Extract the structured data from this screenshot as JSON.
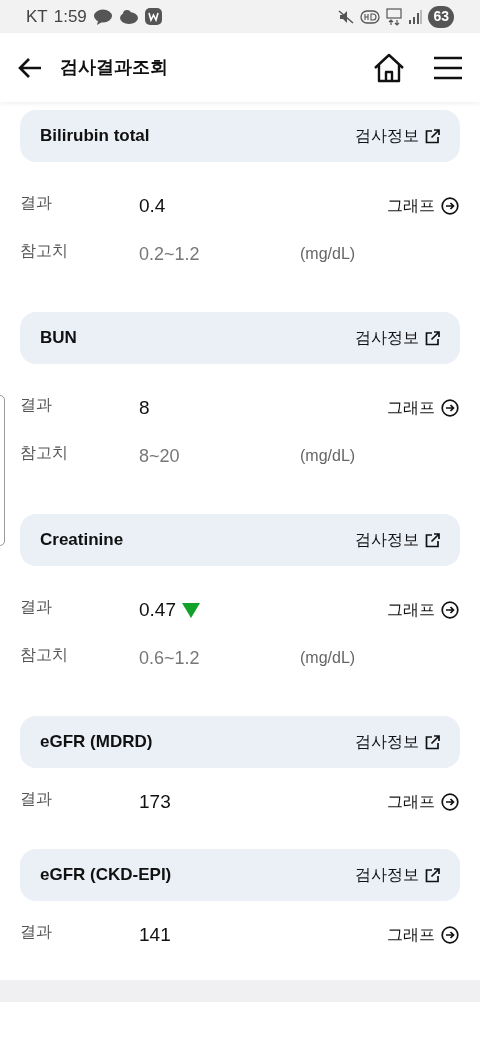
{
  "status_bar": {
    "carrier": "KT",
    "time": "1:59",
    "battery": "63"
  },
  "header": {
    "title": "검사결과조회"
  },
  "tests": [
    {
      "name": "Bilirubin total",
      "info_link": "검사정보",
      "result_label": "결과",
      "result": "0.4",
      "below_range": false,
      "graph_link": "그래프",
      "reference_label": "참고치",
      "reference": "0.2~1.2",
      "unit": "(mg/dL)"
    },
    {
      "name": "BUN",
      "info_link": "검사정보",
      "result_label": "결과",
      "result": "8",
      "below_range": false,
      "graph_link": "그래프",
      "reference_label": "참고치",
      "reference": "8~20",
      "unit": "(mg/dL)"
    },
    {
      "name": "Creatinine",
      "info_link": "검사정보",
      "result_label": "결과",
      "result": "0.47",
      "below_range": true,
      "graph_link": "그래프",
      "reference_label": "참고치",
      "reference": "0.6~1.2",
      "unit": "(mg/dL)"
    },
    {
      "name": "eGFR (MDRD)",
      "info_link": "검사정보",
      "result_label": "결과",
      "result": "173",
      "below_range": false,
      "graph_link": "그래프"
    },
    {
      "name": "eGFR (CKD-EPI)",
      "info_link": "검사정보",
      "result_label": "결과",
      "result": "141",
      "below_range": false,
      "graph_link": "그래프"
    }
  ]
}
